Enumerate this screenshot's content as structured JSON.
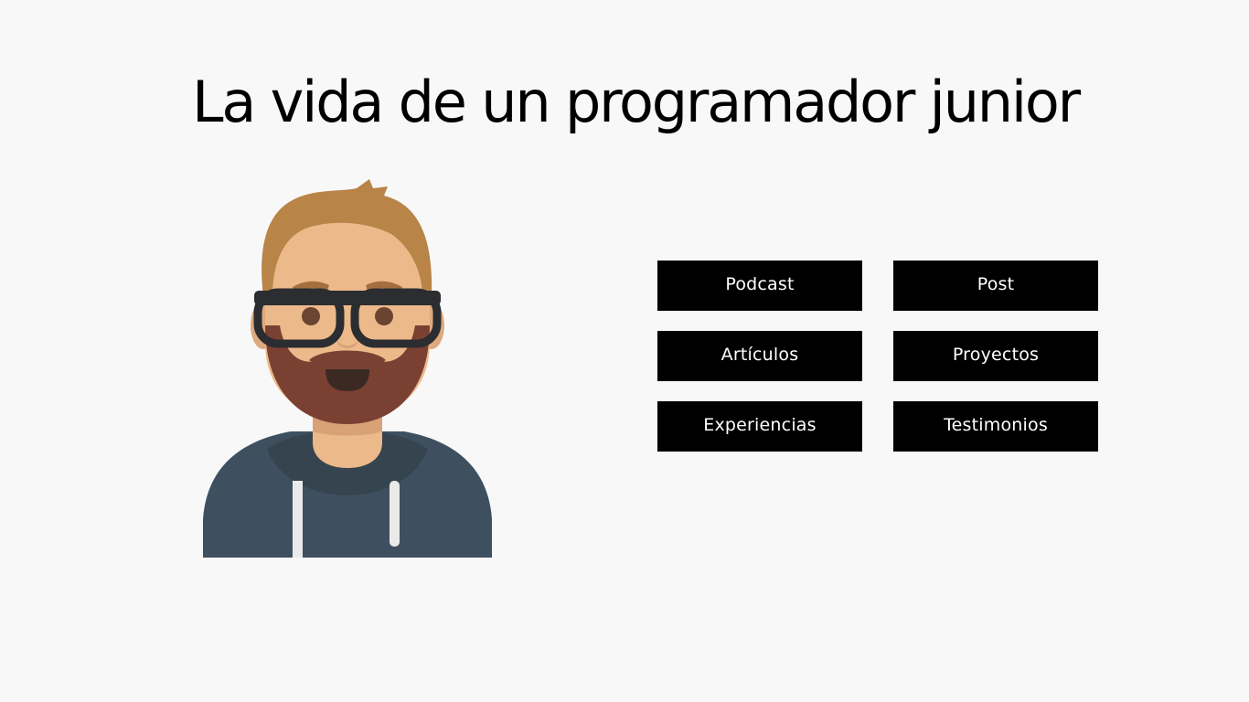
{
  "page": {
    "title": "La vida de un programador junior"
  },
  "avatar": {
    "icon": "developer-avatar-icon"
  },
  "nav": {
    "buttons": [
      {
        "label": "Podcast"
      },
      {
        "label": "Post"
      },
      {
        "label": "Artículos"
      },
      {
        "label": "Proyectos"
      },
      {
        "label": "Experiencias"
      },
      {
        "label": "Testimonios"
      }
    ]
  },
  "colors": {
    "background": "#f8f8f8",
    "button_bg": "#000000",
    "button_text": "#ffffff",
    "hair": "#b88447",
    "skin": "#ecb98a",
    "beard": "#7a4133",
    "hoodie": "#3e5060"
  }
}
